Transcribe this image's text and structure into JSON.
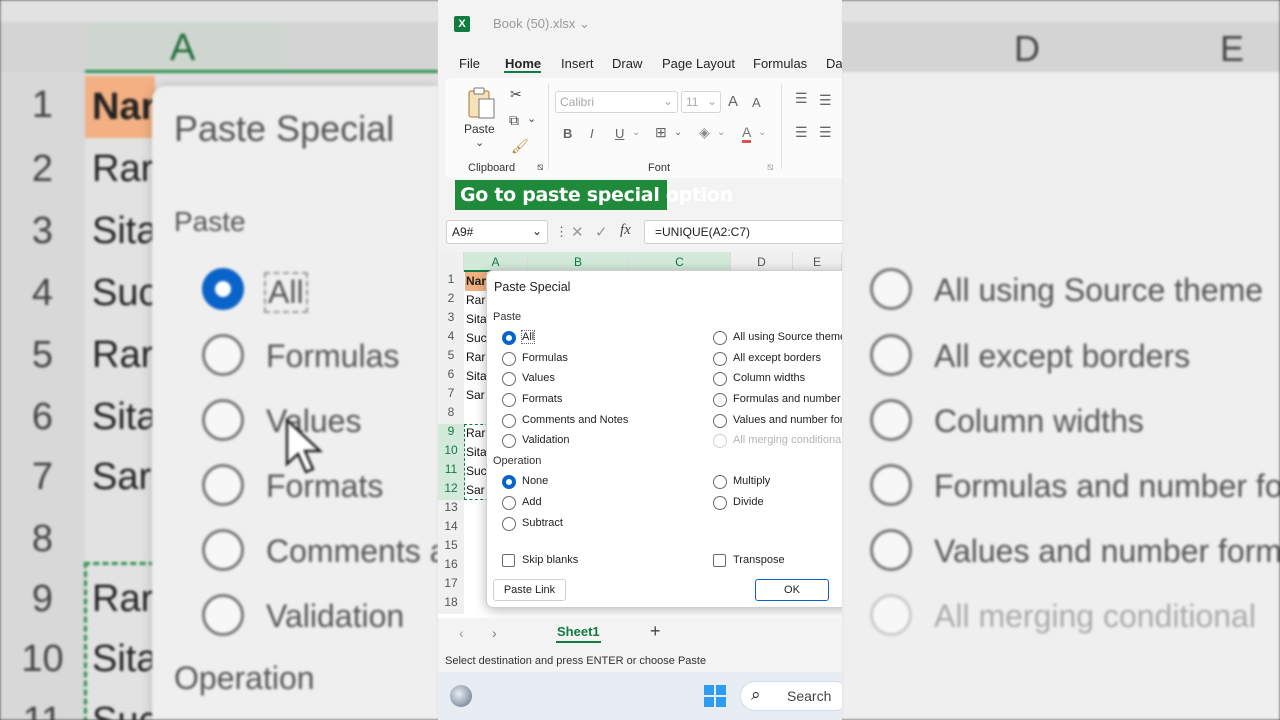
{
  "app": {
    "doc_title": "Book (50).xlsx"
  },
  "menu": [
    "File",
    "Home",
    "Insert",
    "Draw",
    "Page Layout",
    "Formulas",
    "Da"
  ],
  "ribbon": {
    "paste_label": "Paste",
    "clipboard_label": "Clipboard",
    "font_name": "Calibri",
    "font_size": "11",
    "font_label": "Font",
    "bold": "B",
    "italic": "I",
    "underline": "U",
    "grow": "A",
    "shrink": "A"
  },
  "banner": "Go to paste special option",
  "formula_bar": {
    "name_box": "A9#",
    "fx": "fx",
    "formula": "=UNIQUE(A2:C7)"
  },
  "grid": {
    "columns": [
      "A",
      "B",
      "C",
      "D",
      "E"
    ],
    "rows": [
      "1",
      "2",
      "3",
      "4",
      "5",
      "6",
      "7",
      "8",
      "9",
      "10",
      "11",
      "12",
      "13",
      "14",
      "15",
      "16",
      "17",
      "18"
    ],
    "cells": [
      "Nar",
      "Rar",
      "Sita",
      "Suc",
      "Rar",
      "Sita",
      "Sar",
      "",
      "Rar",
      "Sita",
      "Suc",
      "Sar"
    ]
  },
  "dialog": {
    "title": "Paste Special",
    "paste_section": "Paste",
    "paste_left": [
      "All",
      "Formulas",
      "Values",
      "Formats",
      "Comments and Notes",
      "Validation"
    ],
    "paste_right": [
      "All using Source theme",
      "All except borders",
      "Column widths",
      "Formulas and number fo",
      "Values and number form",
      "All merging conditional"
    ],
    "operation_section": "Operation",
    "operation_left": [
      "None",
      "Add",
      "Subtract"
    ],
    "operation_right": [
      "Multiply",
      "Divide"
    ],
    "skip_blanks": "Skip blanks",
    "transpose": "Transpose",
    "paste_link": "Paste Link",
    "ok": "OK"
  },
  "sheet": {
    "tab": "Sheet1",
    "add": "+"
  },
  "status": "Select destination and press ENTER or choose Paste",
  "taskbar": {
    "search": "Search"
  },
  "background": {
    "col_a": "A",
    "col_d": "D",
    "col_e": "E",
    "row_numbers": [
      "1",
      "2",
      "3",
      "4",
      "5",
      "6",
      "7",
      "8",
      "9",
      "10",
      "11"
    ],
    "cells": [
      "Nar",
      "Rar",
      "Sita",
      "Suc",
      "Rar",
      "Sita",
      "Sar",
      "",
      "Rar",
      "Sita",
      "Suc"
    ],
    "dialog_title": "Paste Special",
    "paste": "Paste",
    "left_options": [
      "All",
      "Formulas",
      "Values",
      "Formats",
      "Comments a",
      "Validation"
    ],
    "operation": "Operation",
    "right_options": [
      "All using Source theme",
      "All except borders",
      "Column widths",
      "Formulas and number fo",
      "Values and number form",
      "All merging conditional"
    ]
  },
  "colors": {
    "accent": "#107c41",
    "radio": "#0a63c9",
    "banner": "#1f8a3a",
    "header_cell": "#f3b083"
  }
}
